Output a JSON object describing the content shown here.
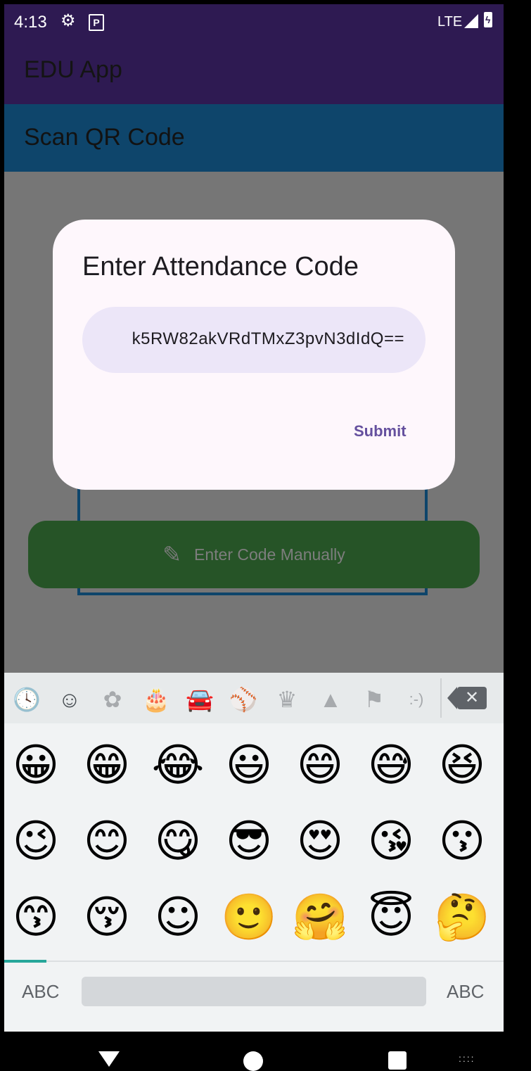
{
  "status_bar": {
    "time": "4:13",
    "network": "LTE",
    "icons": [
      "gear-icon",
      "parking-icon",
      "signal-icon",
      "battery-charging-icon"
    ]
  },
  "app_bar": {
    "title": "EDU App"
  },
  "sub_bar": {
    "title": "Scan QR Code"
  },
  "background": {
    "manual_button_label": "Enter Code Manually",
    "manual_button_icon": "pencil-icon"
  },
  "dialog": {
    "title": "Enter Attendance Code",
    "code_value": "k5RW82akVRdTMxZ3pvN3dIdQ==",
    "submit_label": "Submit"
  },
  "keyboard": {
    "categories": [
      {
        "name": "recent-icon",
        "glyph": "🕓"
      },
      {
        "name": "smileys-icon",
        "glyph": "☺"
      },
      {
        "name": "flower-icon",
        "glyph": "✿"
      },
      {
        "name": "cake-icon",
        "glyph": "🎂"
      },
      {
        "name": "car-icon",
        "glyph": "🚘"
      },
      {
        "name": "ball-icon",
        "glyph": "⚾"
      },
      {
        "name": "crown-icon",
        "glyph": "♛"
      },
      {
        "name": "triangle-icon",
        "glyph": "▲"
      },
      {
        "name": "flag-icon",
        "glyph": "⚑"
      },
      {
        "name": "emoticon-icon",
        "glyph": ":-)"
      }
    ],
    "selected_category": "smileys",
    "emoji_rows": [
      [
        "😀",
        "😁",
        "😂",
        "😃",
        "😄",
        "😅",
        "😆"
      ],
      [
        "😉",
        "😊",
        "😋",
        "😎",
        "😍",
        "😘",
        "😗"
      ],
      [
        "😙",
        "😚",
        "☺",
        "🙂",
        "🤗",
        "😇",
        "🤔"
      ]
    ],
    "left_abc": "ABC",
    "right_abc": "ABC"
  },
  "colors": {
    "app_bar": "#2e1a52",
    "sub_bar": "#0e456b",
    "dialog_bg": "#fef7fc",
    "field_bg": "#ece6f8",
    "submit_text": "#65509e",
    "manual_button": "#265427",
    "page_indicator": "#26a69a"
  }
}
